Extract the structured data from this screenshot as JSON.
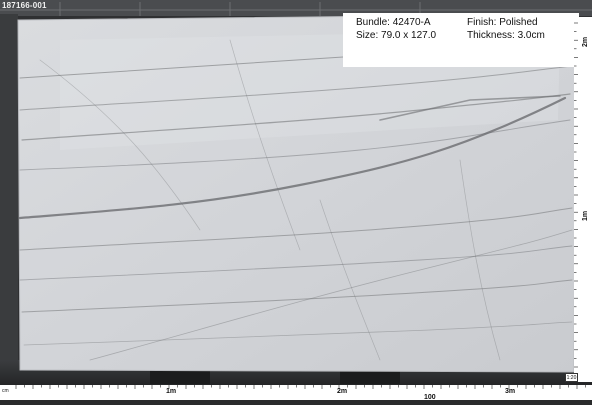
{
  "image_id_label": "187166-001",
  "info_panel": {
    "bundle_label": "Bundle:",
    "bundle_value": "42470-A",
    "finish_label": "Finish:",
    "finish_value": "Polished",
    "size_label": "Size:",
    "size_value": "79.0 x 127.0",
    "thickness_label": "Thickness:",
    "thickness_value": "3.0cm"
  },
  "rulers": {
    "horizontal_major": [
      "1m",
      "2m",
      "3m"
    ],
    "horizontal_center": "100",
    "horizontal_start": "cm",
    "vertical_major": [
      "2m",
      "1m"
    ]
  },
  "scale_badge": "1:20",
  "colors": {
    "slab": "#d7d9dd",
    "background": "#2a2b2c",
    "vein": "#6b6d70",
    "ruler": "#ffffff"
  }
}
